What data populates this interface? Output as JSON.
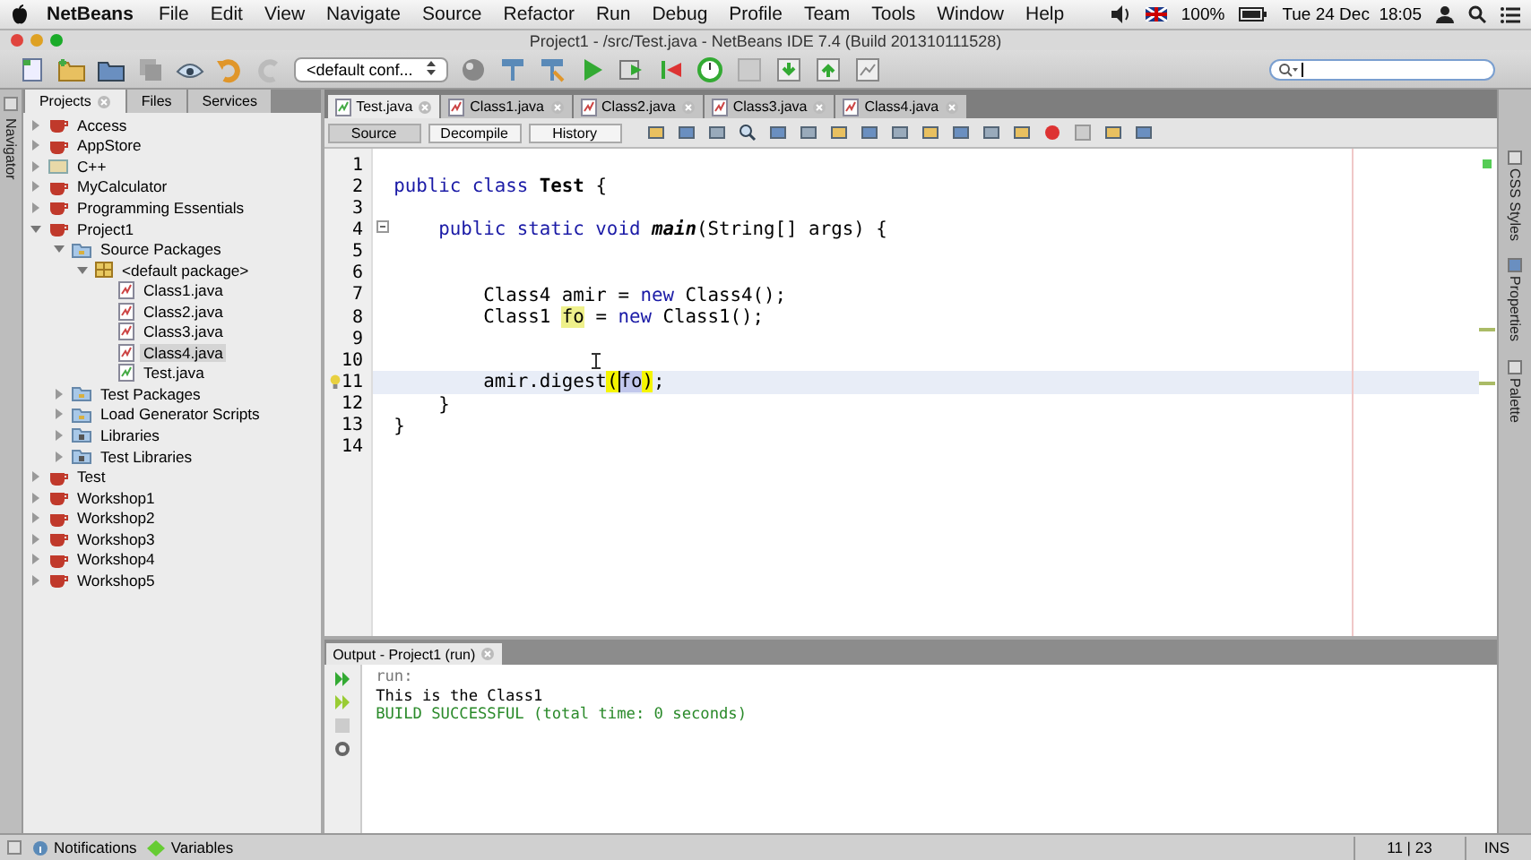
{
  "menubar": {
    "app": "NetBeans",
    "menus": [
      "File",
      "Edit",
      "View",
      "Navigate",
      "Source",
      "Refactor",
      "Run",
      "Debug",
      "Profile",
      "Team",
      "Tools",
      "Window",
      "Help"
    ],
    "battery": "100%",
    "clock": "Tue 24 Dec  18:05"
  },
  "window": {
    "title": "Project1 - /src/Test.java - NetBeans IDE 7.4 (Build 201310111528)"
  },
  "toolbar": {
    "configuration": "<default conf..."
  },
  "navigator_strip": {
    "label": "Navigator"
  },
  "projects_panel": {
    "tabs": [
      {
        "label": "Projects",
        "selected": true
      },
      {
        "label": "Files",
        "selected": false
      },
      {
        "label": "Services",
        "selected": false
      }
    ],
    "tree": [
      {
        "label": "Access",
        "kind": "project",
        "expanded": false,
        "selected": false
      },
      {
        "label": "AppStore",
        "kind": "project",
        "expanded": false,
        "selected": false
      },
      {
        "label": "C++",
        "kind": "cpp",
        "expanded": false,
        "selected": false
      },
      {
        "label": "MyCalculator",
        "kind": "project",
        "expanded": false,
        "selected": false
      },
      {
        "label": "Programming Essentials",
        "kind": "project",
        "expanded": false,
        "selected": false
      },
      {
        "label": "Project1",
        "kind": "project",
        "expanded": true,
        "selected": false,
        "children": [
          {
            "label": "Source Packages",
            "kind": "folder",
            "expanded": true,
            "selected": false,
            "children": [
              {
                "label": "<default package>",
                "kind": "package",
                "expanded": true,
                "selected": false,
                "children": [
                  {
                    "label": "Class1.java",
                    "kind": "java",
                    "selected": false
                  },
                  {
                    "label": "Class2.java",
                    "kind": "java",
                    "selected": false
                  },
                  {
                    "label": "Class3.java",
                    "kind": "java",
                    "selected": false
                  },
                  {
                    "label": "Class4.java",
                    "kind": "java",
                    "selected": true
                  },
                  {
                    "label": "Test.java",
                    "kind": "main-java",
                    "selected": false
                  }
                ]
              }
            ]
          },
          {
            "label": "Test Packages",
            "kind": "folder",
            "expanded": false,
            "selected": false
          },
          {
            "label": "Load Generator Scripts",
            "kind": "folder",
            "expanded": false,
            "selected": false
          },
          {
            "label": "Libraries",
            "kind": "library",
            "expanded": false,
            "selected": false
          },
          {
            "label": "Test Libraries",
            "kind": "library",
            "expanded": false,
            "selected": false
          }
        ]
      },
      {
        "label": "Test",
        "kind": "project",
        "expanded": false,
        "selected": false
      },
      {
        "label": "Workshop1",
        "kind": "project",
        "expanded": false,
        "selected": false
      },
      {
        "label": "Workshop2",
        "kind": "project",
        "expanded": false,
        "selected": false
      },
      {
        "label": "Workshop3",
        "kind": "project",
        "expanded": false,
        "selected": false
      },
      {
        "label": "Workshop4",
        "kind": "project",
        "expanded": false,
        "selected": false
      },
      {
        "label": "Workshop5",
        "kind": "project",
        "expanded": false,
        "selected": false
      }
    ]
  },
  "editor": {
    "tabs": [
      {
        "label": "Test.java",
        "selected": true
      },
      {
        "label": "Class1.java",
        "selected": false
      },
      {
        "label": "Class2.java",
        "selected": false
      },
      {
        "label": "Class3.java",
        "selected": false
      },
      {
        "label": "Class4.java",
        "selected": false
      }
    ],
    "views": [
      {
        "label": "Source",
        "selected": true
      },
      {
        "label": "Decompile",
        "selected": false
      },
      {
        "label": "History",
        "selected": false
      }
    ],
    "lines": [
      {
        "number": "1",
        "current": false
      },
      {
        "number": "2",
        "current": false,
        "segments": [
          {
            "text": "public class ",
            "kind": "keyword"
          },
          {
            "text": "Test",
            "kind": "bold"
          },
          {
            "text": " {",
            "kind": "plain"
          }
        ]
      },
      {
        "number": "3",
        "current": false
      },
      {
        "number": "4",
        "current": false,
        "segments": [
          {
            "text": "    public static void ",
            "kind": "keyword"
          },
          {
            "text": "main",
            "kind": "bold-italic"
          },
          {
            "text": "(String[] args) {",
            "kind": "plain"
          }
        ]
      },
      {
        "number": "5",
        "current": false
      },
      {
        "number": "6",
        "current": false
      },
      {
        "number": "7",
        "current": false,
        "segments": [
          {
            "text": "        Class4 amir = ",
            "kind": "plain"
          },
          {
            "text": "new",
            "kind": "keyword"
          },
          {
            "text": " Class4();",
            "kind": "plain"
          }
        ]
      },
      {
        "number": "8",
        "current": false,
        "segments": [
          {
            "text": "        Class1 ",
            "kind": "plain"
          },
          {
            "text": "fo",
            "kind": "occurrence"
          },
          {
            "text": " = ",
            "kind": "plain"
          },
          {
            "text": "new",
            "kind": "keyword"
          },
          {
            "text": " Class1();",
            "kind": "plain"
          }
        ]
      },
      {
        "number": "9",
        "current": false
      },
      {
        "number": "10",
        "current": false
      },
      {
        "number": "11",
        "current": true,
        "segments": [
          {
            "text": "        amir.digest",
            "kind": "plain"
          },
          {
            "text": "(",
            "kind": "brace-match"
          },
          {
            "text": "fo",
            "kind": "caret-occurrence"
          },
          {
            "text": ")",
            "kind": "brace-match"
          },
          {
            "text": ";",
            "kind": "plain"
          }
        ]
      },
      {
        "number": "12",
        "current": false,
        "segments": [
          {
            "text": "    }",
            "kind": "plain"
          }
        ]
      },
      {
        "number": "13",
        "current": false,
        "segments": [
          {
            "text": "}",
            "kind": "plain"
          }
        ]
      },
      {
        "number": "14",
        "current": false
      }
    ]
  },
  "right_strip": {
    "items": [
      "CSS Styles",
      "Properties",
      "Palette"
    ]
  },
  "output": {
    "title": "Output - Project1 (run)",
    "lines": [
      {
        "text": "run:",
        "kind": "muted"
      },
      {
        "text": "This is the Class1",
        "kind": "plain"
      },
      {
        "text": "BUILD SUCCESSFUL (total time: 0 seconds)",
        "kind": "success"
      }
    ]
  },
  "status_bar": {
    "notifications": "Notifications",
    "variables": "Variables",
    "position": "11 | 23",
    "mode": "INS"
  }
}
